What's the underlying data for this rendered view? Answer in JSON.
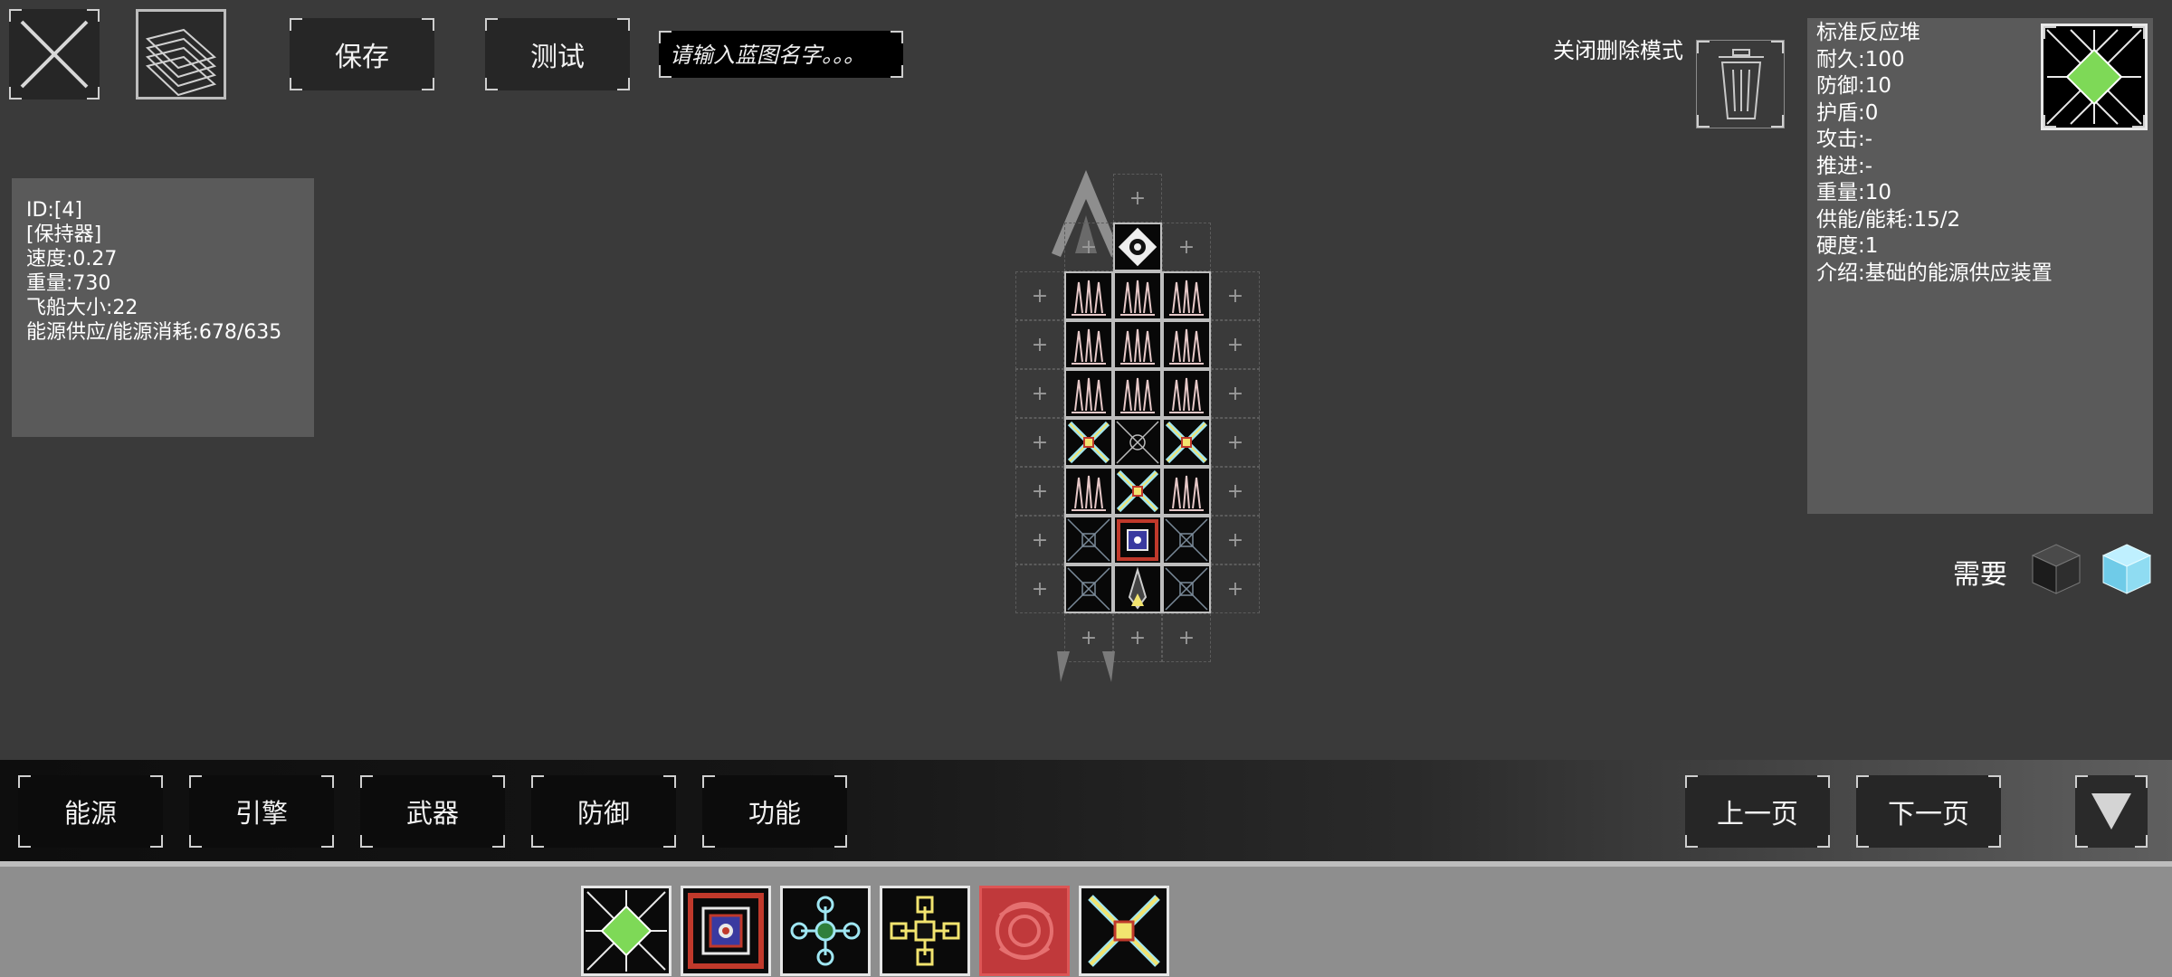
{
  "toolbar": {
    "save_label": "保存",
    "test_label": "测试",
    "blueprint_placeholder": "请输入蓝图名字。。。"
  },
  "ship_info": {
    "id": "ID:[4]",
    "holder": "[保持器]",
    "speed": "速度:0.27",
    "weight": "重量:730",
    "size": "飞船大小:22",
    "energy": "能源供应/能源消耗:678/635"
  },
  "delete_mode_label": "关闭删除模式",
  "module_info": {
    "name": "标准反应堆",
    "durability": "耐久:100",
    "defense": "防御:10",
    "shield": "护盾:0",
    "attack": "攻击:-",
    "thrust": "推进:-",
    "weight": "重量:10",
    "power": "供能/能耗:15/2",
    "hardness": "硬度:1",
    "description": "介绍:基础的能源供应装置"
  },
  "require_label": "需要",
  "categories": [
    {
      "label": "能源"
    },
    {
      "label": "引擎"
    },
    {
      "label": "武器"
    },
    {
      "label": "防御"
    },
    {
      "label": "功能"
    }
  ],
  "pager": {
    "prev_label": "上一页",
    "next_label": "下一页"
  },
  "colors": {
    "background": "#3a3a3a",
    "reactor_green": "#7ed957",
    "panel": "#5a5a5a",
    "tray": "#8e8e8e"
  }
}
